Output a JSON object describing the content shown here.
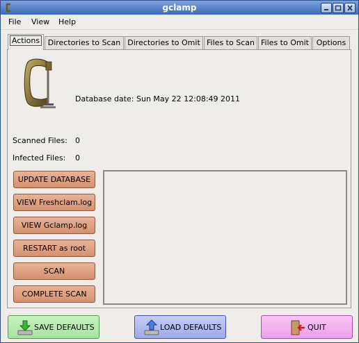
{
  "window": {
    "title": "gclamp"
  },
  "menu": [
    "File",
    "View",
    "Help"
  ],
  "tabs": [
    "Actions",
    "Directories to Scan",
    "Directories to Omit",
    "Files to Scan",
    "Files to Omit",
    "Options"
  ],
  "active_tab": "Actions",
  "actions": {
    "database_date_label": "Database date:",
    "database_date_value": "Sun May 22 12:08:49 2011",
    "scanned_label": "Scanned Files:",
    "scanned_value": "0",
    "infected_label": "Infected Files:",
    "infected_value": "0",
    "buttons": [
      "UPDATE DATABASE",
      "VIEW Freshclam.log",
      "VIEW Gclamp.log",
      "RESTART as root",
      "SCAN",
      "COMPLETE SCAN"
    ],
    "button_color": "#d99c7b"
  },
  "bottom": {
    "save_label": "SAVE DEFAULTS",
    "load_label": "LOAD DEFAULTS",
    "quit_label": "QUIT"
  },
  "icons": [
    "clamp-logo-icon",
    "minimize-icon",
    "maximize-icon",
    "close-icon",
    "download-arrow-icon",
    "upload-arrow-icon",
    "exit-door-icon"
  ]
}
